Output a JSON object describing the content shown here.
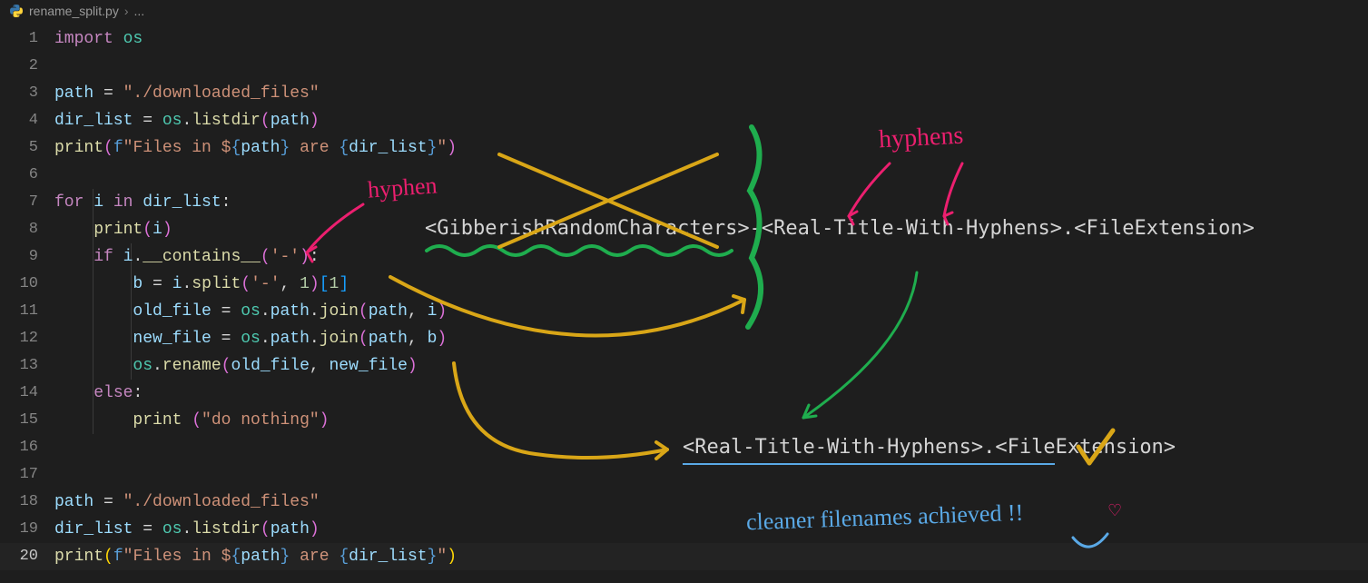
{
  "breadcrumb": {
    "file": "rename_split.py",
    "tail": "..."
  },
  "lineNumbers": [
    "1",
    "2",
    "3",
    "4",
    "5",
    "6",
    "7",
    "8",
    "9",
    "10",
    "11",
    "12",
    "13",
    "14",
    "15",
    "16",
    "17",
    "18",
    "19",
    "20"
  ],
  "currentLine": 20,
  "code": {
    "l1": {
      "t0": "import ",
      "t1": "os"
    },
    "l3": {
      "t0": "path ",
      "t1": "= ",
      "t2": "\"./downloaded_files\""
    },
    "l4": {
      "t0": "dir_list ",
      "t1": "= ",
      "t2": "os",
      "t3": ".",
      "t4": "listdir",
      "t5": "(",
      "t6": "path",
      "t7": ")"
    },
    "l5": {
      "t0": "print",
      "t1": "(",
      "t2": "f",
      "t3": "\"Files in $",
      "t4": "{",
      "t5": "path",
      "t6": "}",
      "t7": " are ",
      "t8": "{",
      "t9": "dir_list",
      "t10": "}",
      "t11": "\"",
      "t12": ")"
    },
    "l7": {
      "t0": "for ",
      "t1": "i ",
      "t2": "in ",
      "t3": "dir_list",
      "t4": ":"
    },
    "l8": {
      "t0": "print",
      "t1": "(",
      "t2": "i",
      "t3": ")"
    },
    "l9": {
      "t0": "if ",
      "t1": "i",
      "t2": ".",
      "t3": "__contains__",
      "t4": "(",
      "t5": "'-'",
      "t6": ")",
      "t7": ":"
    },
    "l10": {
      "t0": "b ",
      "t1": "= ",
      "t2": "i",
      "t3": ".",
      "t4": "split",
      "t5": "(",
      "t6": "'-'",
      "t7": ", ",
      "t8": "1",
      "t9": ")",
      "t10": "[",
      "t11": "1",
      "t12": "]"
    },
    "l11": {
      "t0": "old_file ",
      "t1": "= ",
      "t2": "os",
      "t3": ".",
      "t4": "path",
      "t5": ".",
      "t6": "join",
      "t7": "(",
      "t8": "path",
      "t9": ", ",
      "t10": "i",
      "t11": ")"
    },
    "l12": {
      "t0": "new_file ",
      "t1": "= ",
      "t2": "os",
      "t3": ".",
      "t4": "path",
      "t5": ".",
      "t6": "join",
      "t7": "(",
      "t8": "path",
      "t9": ", ",
      "t10": "b",
      "t11": ")"
    },
    "l13": {
      "t0": "os",
      "t1": ".",
      "t2": "rename",
      "t3": "(",
      "t4": "old_file",
      "t5": ", ",
      "t6": "new_file",
      "t7": ")"
    },
    "l14": {
      "t0": "else",
      "t1": ":"
    },
    "l15": {
      "t0": "print ",
      "t1": "(",
      "t2": "\"do nothing\"",
      "t3": ")"
    },
    "l18": {
      "t0": "path ",
      "t1": "= ",
      "t2": "\"./downloaded_files\""
    },
    "l19": {
      "t0": "dir_list ",
      "t1": "= ",
      "t2": "os",
      "t3": ".",
      "t4": "listdir",
      "t5": "(",
      "t6": "path",
      "t7": ")"
    },
    "l20": {
      "t0": "print",
      "t1": "(",
      "t2": "f",
      "t3": "\"Files in $",
      "t4": "{",
      "t5": "path",
      "t6": "}",
      "t7": " are ",
      "t8": "{",
      "t9": "dir_list",
      "t10": "}",
      "t11": "\"",
      "t12": ")"
    }
  },
  "annotations": {
    "hyphen": "hyphen",
    "hyphens": "hyphens",
    "pattern1": "<GibberishRandomCharacters>-<Real-Title-With-Hyphens>.<FileExtension>",
    "pattern2": "<Real-Title-With-Hyphens>.<FileExtension>",
    "cleaner": "cleaner filenames achieved !!",
    "heart": "♡"
  }
}
